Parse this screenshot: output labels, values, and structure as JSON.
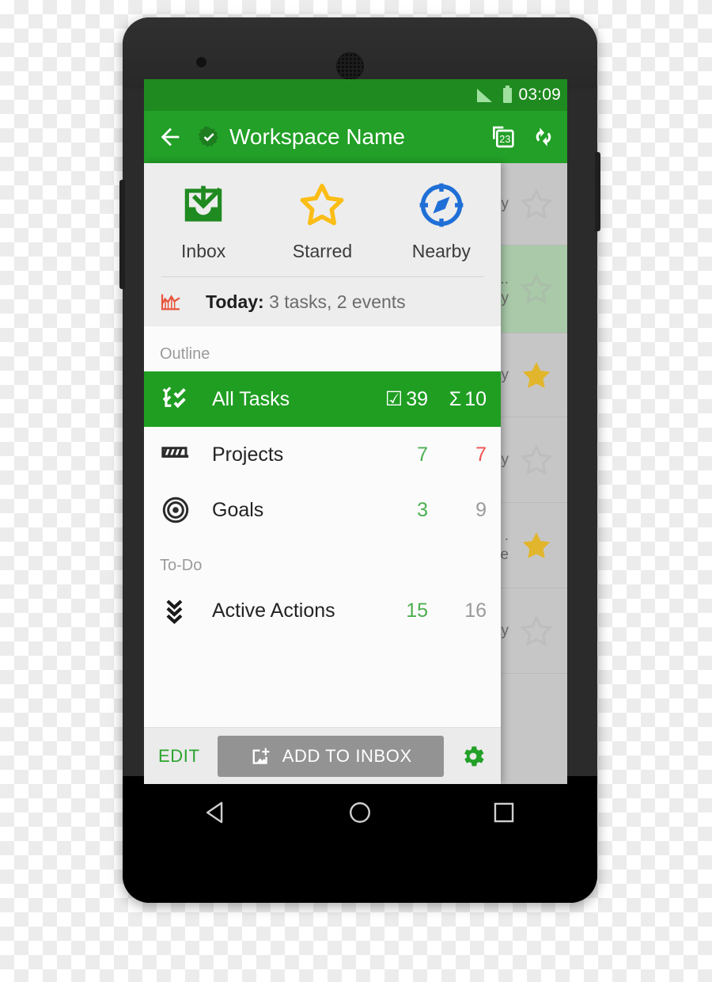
{
  "status_bar": {
    "time": "03:09",
    "signal_icon": "signal-bars-icon",
    "battery_icon": "battery-icon"
  },
  "app_bar": {
    "back_icon": "back-arrow-icon",
    "workspace_badge_icon": "verified-check-badge-icon",
    "title": "Workspace Name",
    "calendar_action": {
      "icon": "calendar-stack-icon",
      "badge": "23"
    },
    "sync_action": {
      "icon": "sync-refresh-icon"
    }
  },
  "drawer": {
    "shortcuts": [
      {
        "label": "Inbox",
        "icon": "inbox-download-icon",
        "color": "#1f8a20"
      },
      {
        "label": "Starred",
        "icon": "star-outline-icon",
        "color": "#fbbd16"
      },
      {
        "label": "Nearby",
        "icon": "compass-icon",
        "color": "#1f6fd6"
      }
    ],
    "today": {
      "icon": "chart-line-icon",
      "icon_color": "#e8543b",
      "label": "Today:",
      "summary": " 3 tasks, 2 events"
    },
    "sections": [
      {
        "header": "Outline",
        "rows": [
          {
            "label": "All Tasks",
            "icon": "tasks-checklist-icon",
            "active": true,
            "count_left": "39",
            "count_left_glyph": "☑",
            "count_left_color": "white",
            "count_right": "10",
            "count_right_glyph": "Σ",
            "count_right_color": "white"
          },
          {
            "label": "Projects",
            "icon": "projects-stripes-icon",
            "active": false,
            "count_left": "7",
            "count_left_glyph": "",
            "count_left_color": "green",
            "count_right": "7",
            "count_right_glyph": "",
            "count_right_color": "red"
          },
          {
            "label": "Goals",
            "icon": "goal-target-icon",
            "active": false,
            "count_left": "3",
            "count_left_glyph": "",
            "count_left_color": "green",
            "count_right": "9",
            "count_right_glyph": "",
            "count_right_color": "gray"
          }
        ]
      },
      {
        "header": "To-Do",
        "rows": [
          {
            "label": "Active Actions",
            "icon": "double-chevron-down-icon",
            "active": false,
            "count_left": "15",
            "count_left_glyph": "",
            "count_left_color": "green",
            "count_right": "16",
            "count_right_glyph": "",
            "count_right_color": "gray"
          }
        ]
      }
    ],
    "bottom_bar": {
      "edit_label": "EDIT",
      "add_label": "ADD TO INBOX",
      "add_icon": "add-item-icon",
      "settings_icon": "gear-icon"
    }
  },
  "background_list": {
    "rows": [
      {
        "text": "ny",
        "starred": false,
        "selected": false
      },
      {
        "text": "...\nay",
        "starred": false,
        "selected": true
      },
      {
        "text": "ay",
        "starred": true,
        "selected": false
      },
      {
        "text": "ay",
        "starred": false,
        "selected": false
      },
      {
        "text": ".\ne",
        "starred": true,
        "selected": false
      },
      {
        "text": "ay",
        "starred": false,
        "selected": false
      },
      {
        "text": "",
        "starred": false,
        "selected": false
      }
    ]
  },
  "nav_bar": {
    "back_icon": "nav-back-triangle-icon",
    "home_icon": "nav-home-circle-icon",
    "recents_icon": "nav-recents-square-icon"
  },
  "theme": {
    "primary": "#22a027",
    "primary_dark": "#1f8a20",
    "accent_green": "#4caf50",
    "accent_red": "#ef5350",
    "star_yellow": "#fbbd16",
    "compass_blue": "#1f6fd6",
    "chart_orange": "#e8543b"
  }
}
